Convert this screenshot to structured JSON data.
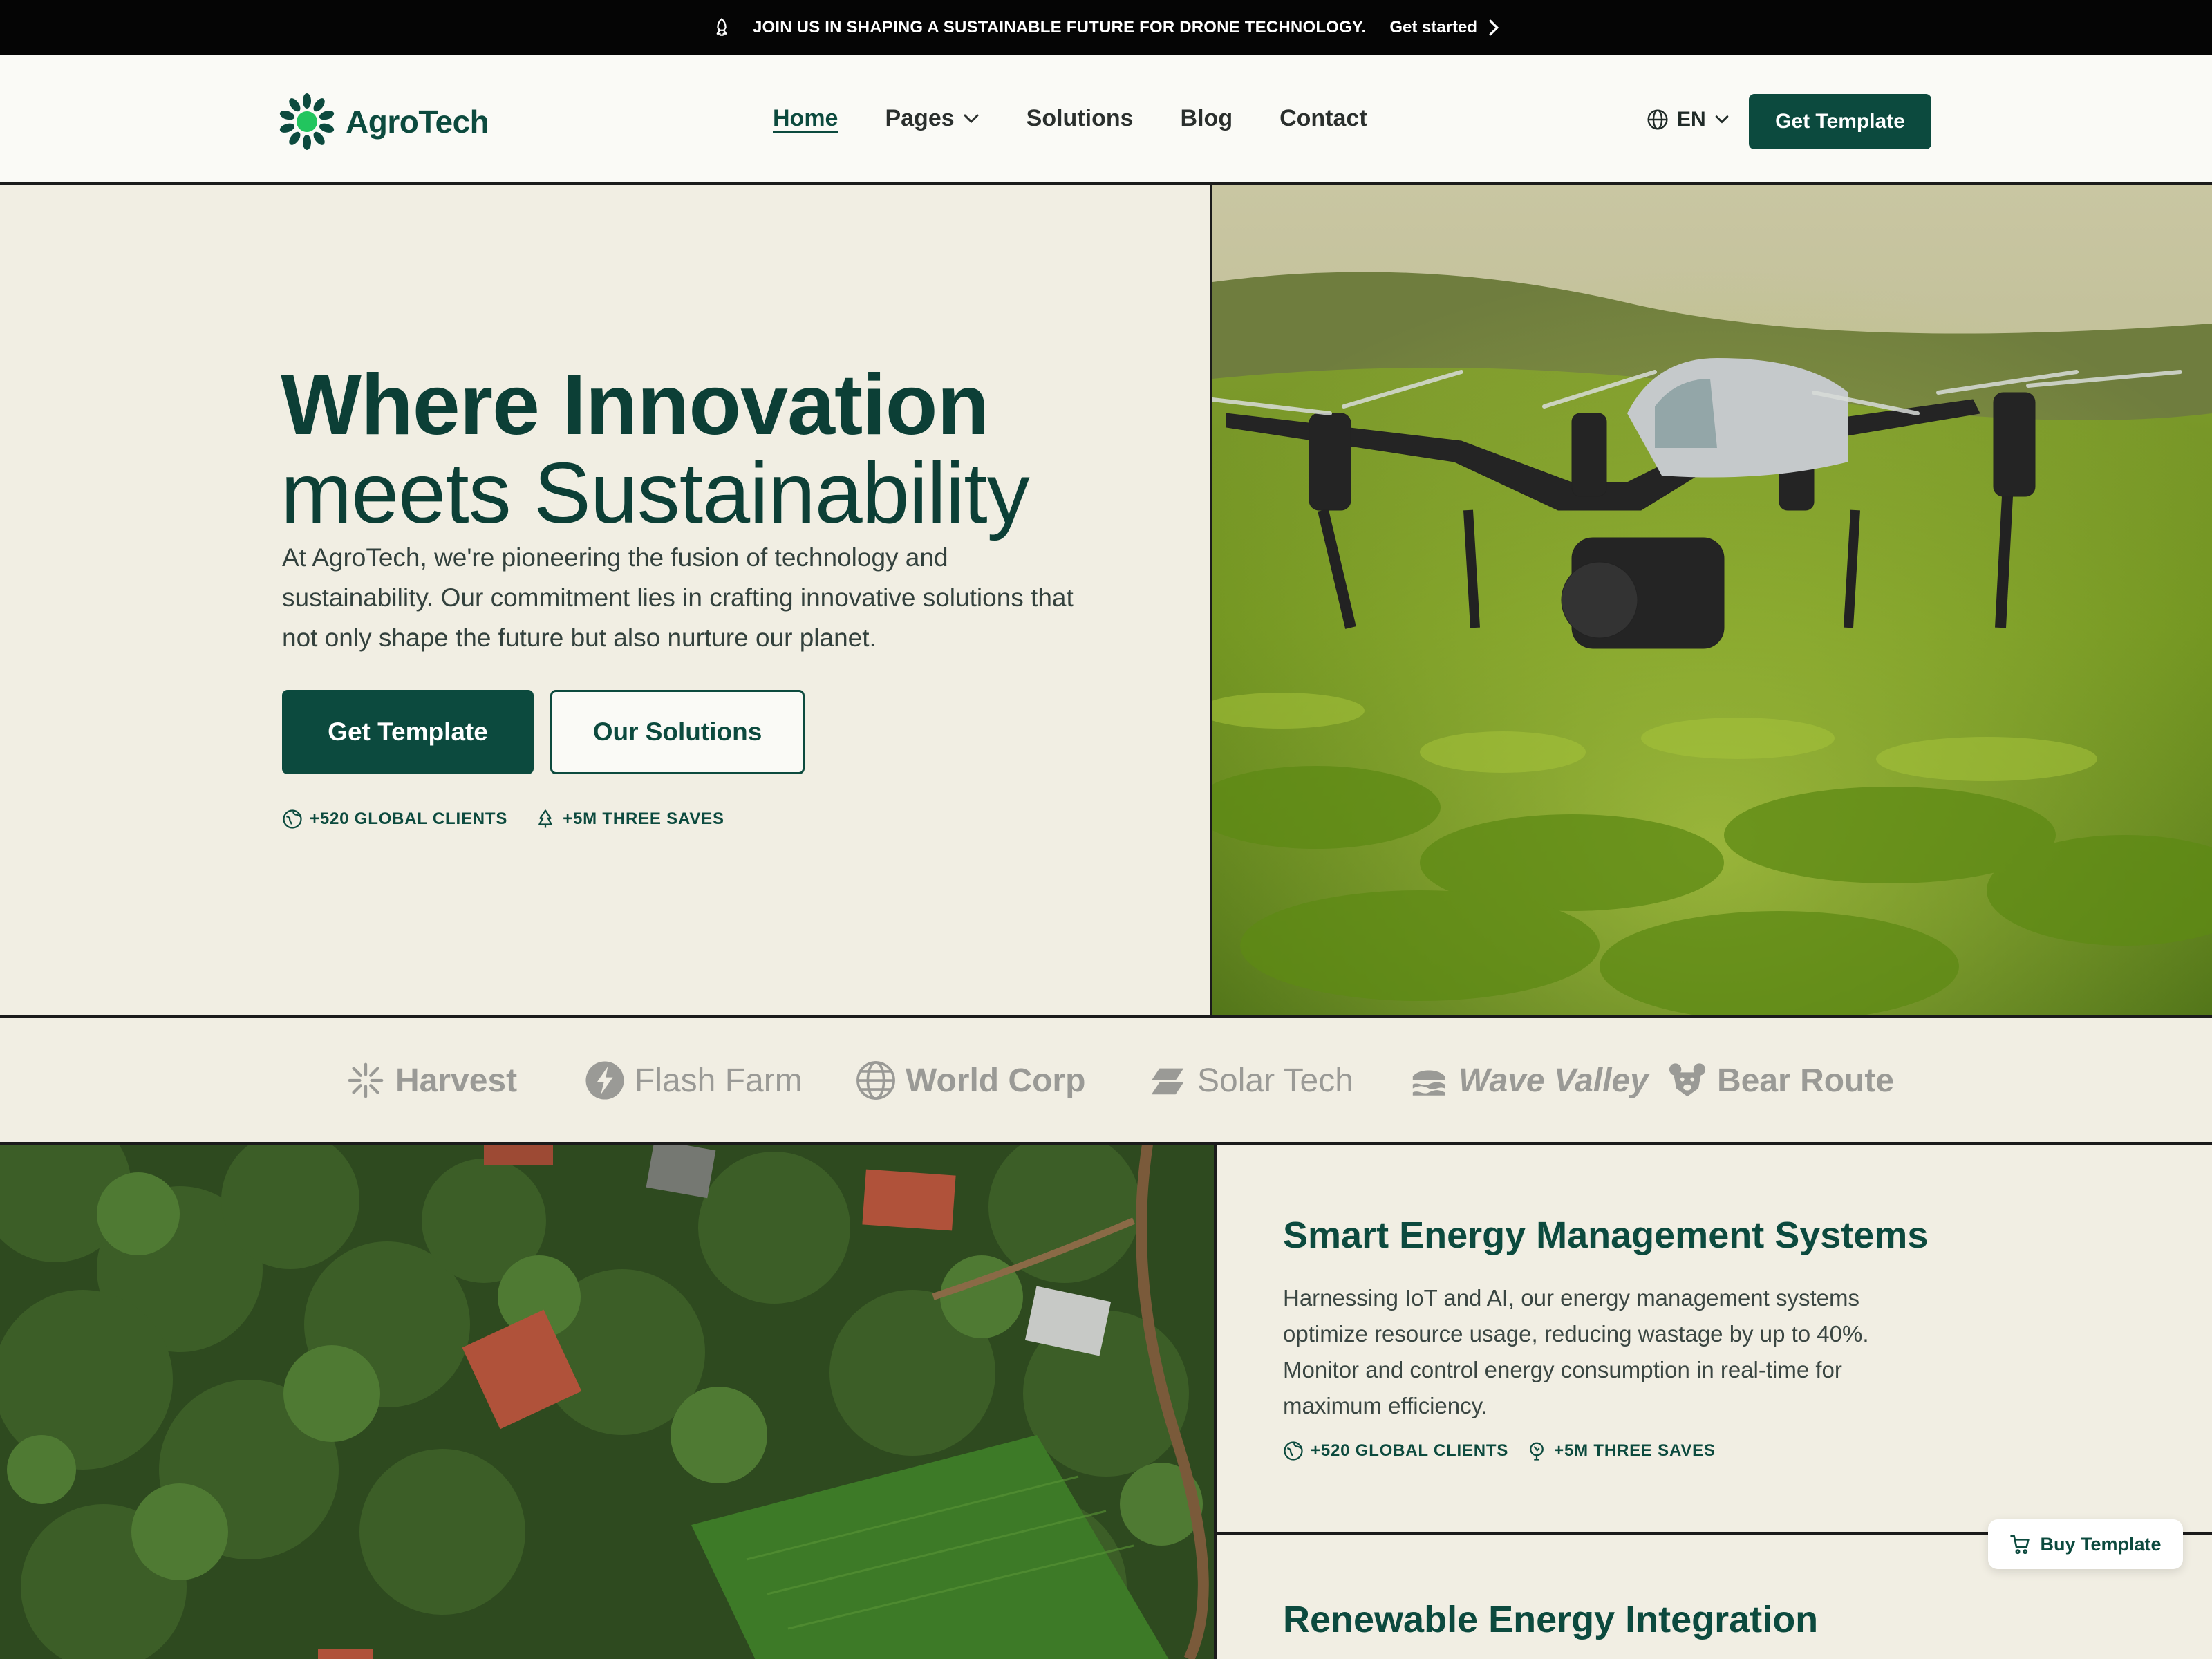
{
  "announcement": {
    "icon": "rocket-icon",
    "text": "JOIN US IN SHAPING A SUSTAINABLE FUTURE FOR DRONE TECHNOLOGY.",
    "link_label": "Get started"
  },
  "header": {
    "brand": "AgroTech",
    "nav": [
      {
        "label": "Home",
        "active": true
      },
      {
        "label": "Pages",
        "has_dropdown": true
      },
      {
        "label": "Solutions"
      },
      {
        "label": "Blog"
      },
      {
        "label": "Contact"
      }
    ],
    "language": "EN",
    "cta_label": "Get Template"
  },
  "hero": {
    "title_line1": "Where Innovation",
    "title_line2": "meets Sustainability",
    "description": "At AgroTech, we're pioneering the fusion of technology and sustainability. Our commitment lies in crafting innovative solutions that not only shape the future but also nurture our planet.",
    "primary_button": "Get Template",
    "secondary_button": "Our Solutions",
    "stats": [
      {
        "icon": "globe-leaf-icon",
        "label": "+520 GLOBAL CLIENTS"
      },
      {
        "icon": "tree-icon",
        "label": "+5M THREE SAVES"
      }
    ]
  },
  "partners": [
    {
      "name": "Harvest",
      "icon": "sunburst-icon"
    },
    {
      "name": "Flash Farm",
      "icon": "bolt-circle-icon"
    },
    {
      "name": "World Corp",
      "icon": "globe-icon"
    },
    {
      "name": "Solar Tech",
      "icon": "solar-panel-icon"
    },
    {
      "name": "Wave Valley",
      "icon": "waves-icon"
    },
    {
      "name": "Bear Route",
      "icon": "bear-icon"
    }
  ],
  "features": [
    {
      "title": "Smart Energy Management Systems",
      "description": "Harnessing IoT and AI, our energy management systems optimize resource usage, reducing wastage by up to 40%. Monitor and control energy consumption in real-time for maximum efficiency.",
      "stats": [
        {
          "icon": "globe-leaf-icon",
          "label": "+520 GLOBAL CLIENTS"
        },
        {
          "icon": "tree-icon",
          "label": "+5M THREE SAVES"
        }
      ]
    },
    {
      "title": "Renewable Energy Integration"
    }
  ],
  "floating_button": {
    "icon": "cart-icon",
    "label": "Buy Template"
  },
  "colors": {
    "brand": "#0c4a3e",
    "background": "#f1eee3",
    "announcement_bg": "#050505",
    "logo_accent": "#22c55e"
  }
}
